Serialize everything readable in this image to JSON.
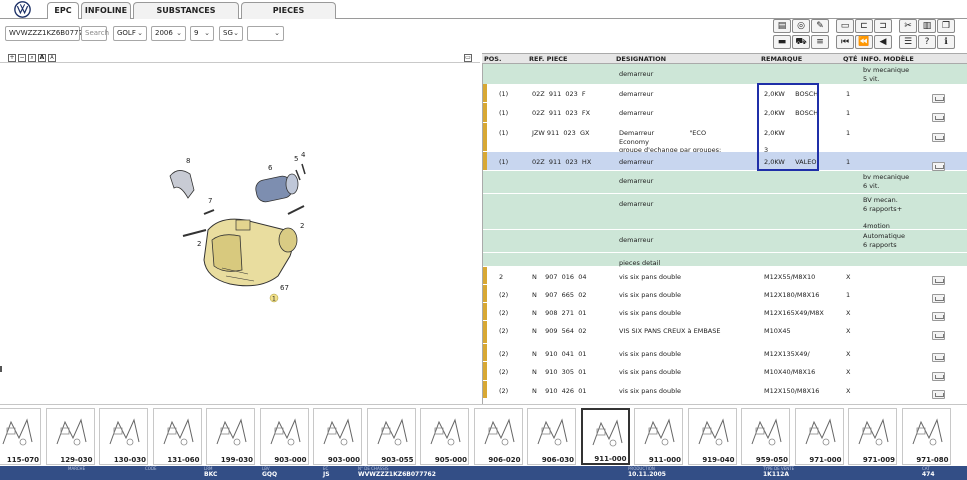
{
  "tabs": [
    {
      "label": "EPC",
      "active": true
    },
    {
      "label": "INFOLINE"
    },
    {
      "label": "SUBSTANCES CHIMIQUES"
    },
    {
      "label": "PIECES NORMALISEES"
    }
  ],
  "filters": {
    "vin": "WVWZZZ1KZ6B077762",
    "search_placeholder": "Search",
    "model": "GOLF",
    "year": "2006",
    "variant": "9",
    "region": "SG",
    "extra": ""
  },
  "table": {
    "headers": {
      "pos": "POS.",
      "ref": "REF. PIECE",
      "designation": "DESIGNATION",
      "remark": "REMARQUE",
      "qty": "QTÉ",
      "info": "INFO. MODÈLE"
    },
    "rows": [
      {
        "pos": "",
        "ref": "",
        "designation": "demarreur",
        "remark": "",
        "qty": "",
        "info": "bv mecanique\n5 vit.",
        "style": "green"
      },
      {
        "pos": "(1)",
        "ref": "02Z  911  023  F",
        "designation": "demarreur",
        "remark": "2,0KW     BOSCH",
        "qty": "1",
        "info": "",
        "style": "white",
        "cart": true,
        "bar": true
      },
      {
        "pos": "(1)",
        "ref": "02Z  911  023  FX",
        "designation": "demarreur",
        "remark": "2,0KW     BOSCH",
        "qty": "1",
        "info": "",
        "style": "white",
        "cart": true,
        "bar": true
      },
      {
        "pos": "(1)",
        "ref": "JZW 911  023  GX",
        "designation": "Demarreur                 \"ECO\nEconomy\ngroupe d'echange par groupes:",
        "remark": "2,0KW\n\n3",
        "qty": "1",
        "info": "",
        "style": "white",
        "cart": true,
        "bar": true
      },
      {
        "pos": "(1)",
        "ref": "02Z  911  023  HX",
        "designation": "demarreur",
        "remark": "2,0KW     VALEO",
        "qty": "1",
        "info": "",
        "style": "blue",
        "cart": true,
        "bar": true
      },
      {
        "pos": "",
        "ref": "",
        "designation": "demarreur",
        "remark": "",
        "qty": "",
        "info": "bv mecanique\n6 vit.",
        "style": "green"
      },
      {
        "pos": "",
        "ref": "",
        "designation": "demarreur",
        "remark": "",
        "qty": "",
        "info": "BV mecan.\n6 rapports+\n\n4motion",
        "style": "green"
      },
      {
        "pos": "",
        "ref": "",
        "designation": "demarreur",
        "remark": "",
        "qty": "",
        "info": "Automatique\n6 rapports",
        "style": "green"
      },
      {
        "pos": "",
        "ref": "",
        "designation": "pieces detail",
        "remark": "",
        "qty": "",
        "info": "",
        "style": "green"
      },
      {
        "pos": "2",
        "ref": "N    907  016  04",
        "designation": "vis six pans double",
        "remark": "M12X55/M8X10",
        "qty": "X",
        "info": "",
        "style": "white",
        "cart": true,
        "bar": true
      },
      {
        "pos": "(2)",
        "ref": "N    907  665  02",
        "designation": "vis six pans double",
        "remark": "M12X180/M8X16",
        "qty": "1",
        "info": "",
        "style": "white",
        "cart": true,
        "bar": true
      },
      {
        "pos": "(2)",
        "ref": "N    908  271  01",
        "designation": "vis six pans double",
        "remark": "M12X165X49/M8X",
        "qty": "X",
        "info": "",
        "style": "white",
        "cart": true,
        "bar": true
      },
      {
        "pos": "(2)",
        "ref": "N    909  564  02",
        "designation": "VIS SIX PANS CREUX à EMBASE",
        "remark": "M10X45",
        "qty": "X",
        "info": "",
        "style": "white",
        "cart": true,
        "bar": true
      },
      {
        "pos": "(2)",
        "ref": "N    910  041  01",
        "designation": "vis six pans double",
        "remark": "M12X135X49/",
        "qty": "X",
        "info": "",
        "style": "white",
        "cart": true,
        "bar": true
      },
      {
        "pos": "(2)",
        "ref": "N    910  305  01",
        "designation": "vis six pans double",
        "remark": "M10X40/M8X16",
        "qty": "X",
        "info": "",
        "style": "white",
        "cart": true,
        "bar": true
      },
      {
        "pos": "(2)",
        "ref": "N    910  426  01",
        "designation": "vis six pans double",
        "remark": "M12X150/M8X16",
        "qty": "X",
        "info": "",
        "style": "white",
        "cart": true,
        "bar": true
      }
    ]
  },
  "callouts": [
    "8",
    "6",
    "5",
    "4",
    "7",
    "2",
    "2",
    "67",
    "1"
  ],
  "thumbnails": [
    "115-070",
    "129-030",
    "130-030",
    "131-060",
    "199-030",
    "903-000",
    "903-000",
    "903-055",
    "905-000",
    "906-020",
    "906-030",
    "911-000",
    "911-000",
    "919-040",
    "959-050",
    "971-000",
    "971-009",
    "971-080"
  ],
  "status": [
    {
      "k": "MARCHÉ",
      "v": ""
    },
    {
      "k": "CODE",
      "v": ""
    },
    {
      "k": "LRM",
      "v": "BKC"
    },
    {
      "k": "LBV",
      "v": "GQQ"
    },
    {
      "k": "EC",
      "v": "JS"
    },
    {
      "k": "N° DE CHASSIS",
      "v": "WVWZZZ1KZ6B077762"
    },
    {
      "k": "PRODUCTION",
      "v": "10.11.2005"
    },
    {
      "k": "TYPE DE VENTE",
      "v": "1K112A"
    },
    {
      "k": "CAT",
      "v": "474"
    }
  ],
  "colors": {
    "status_bar": "#334e86",
    "row_green": "#cde6d7",
    "row_blue": "#c8d6ef",
    "row_white": "#ffffff",
    "highlight_box": "#1f2fa8",
    "accent_bar": "#d8a834"
  }
}
